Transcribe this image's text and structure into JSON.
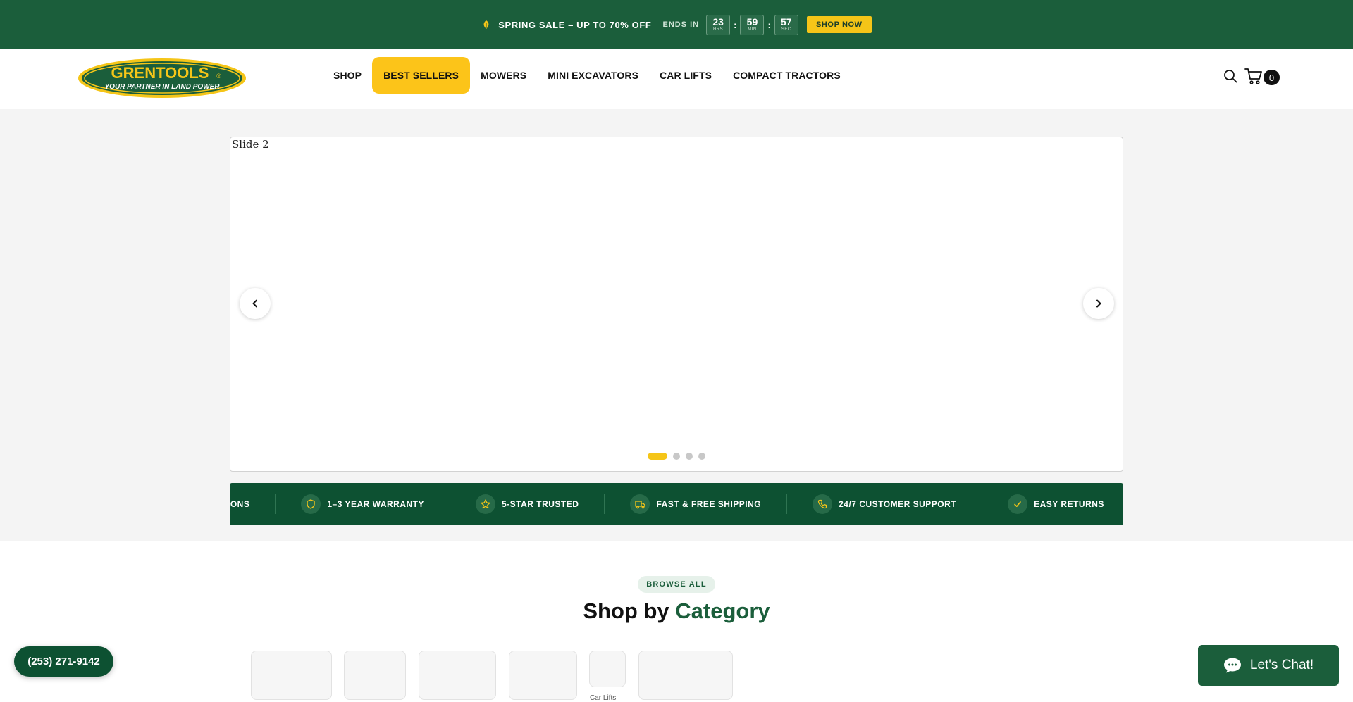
{
  "promo": {
    "text": "SPRING SALE – UP TO 70% OFF",
    "ends_in": "ENDS IN",
    "timer": [
      {
        "value": "23",
        "label": "HRS"
      },
      {
        "value": "59",
        "label": "MIN"
      },
      {
        "value": "57",
        "label": "SEC"
      }
    ],
    "separator": ":",
    "cta": "SHOP NOW"
  },
  "header": {
    "logo": {
      "name": "GRENTOOLS",
      "reg": "®",
      "tagline": "YOUR PARTNER IN LAND POWER"
    },
    "nav": [
      "SHOP",
      "BEST SELLERS",
      "MOWERS",
      "MINI EXCAVATORS",
      "CAR LIFTS",
      "COMPACT TRACTORS"
    ],
    "active_nav": "BEST SELLERS",
    "cart_count": "0"
  },
  "hero": {
    "slide_alt": "Slide 2",
    "slide_count": 4,
    "active_slide": 1
  },
  "trust": [
    {
      "label": "NT OPTIONS",
      "icon": "card-icon"
    },
    {
      "label": "1–3 YEAR WARRANTY",
      "icon": "shield-icon"
    },
    {
      "label": "5-STAR TRUSTED",
      "icon": "star-icon"
    },
    {
      "label": "FAST & FREE SHIPPING",
      "icon": "truck-icon"
    },
    {
      "label": "24/7 CUSTOMER SUPPORT",
      "icon": "phone-icon"
    },
    {
      "label": "EASY RETURNS",
      "icon": "check-icon"
    }
  ],
  "categories": {
    "badge": "BROWSE ALL",
    "title_prefix": "Shop by",
    "title_accent": "Category",
    "partial_label": "Car Lifts"
  },
  "floating": {
    "phone": "(253) 271-9142",
    "chat": "Let's Chat!"
  },
  "colors": {
    "brand_green": "#1b5e3b",
    "dark_green": "#0d5132",
    "accent_yellow": "#f5c518"
  }
}
